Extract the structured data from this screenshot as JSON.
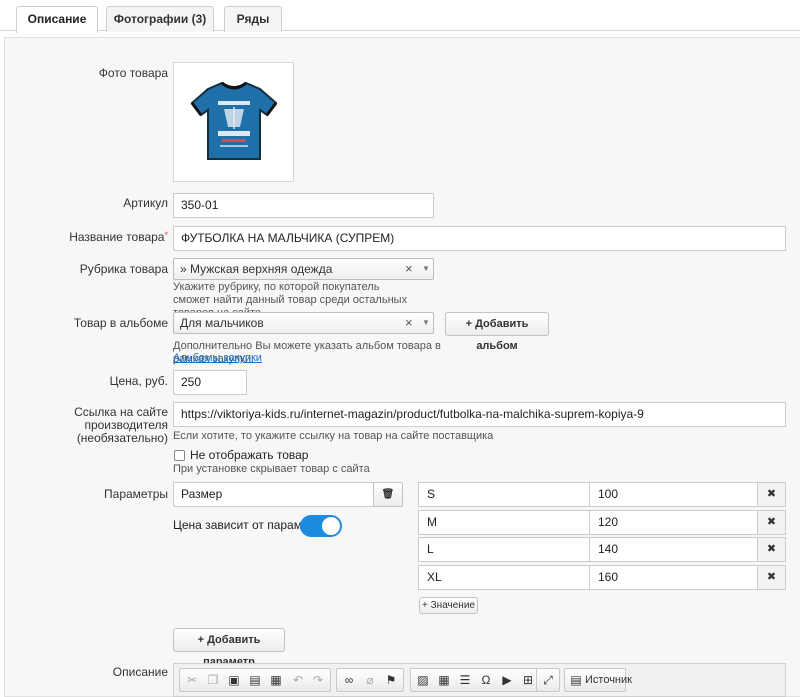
{
  "tabs": [
    {
      "label": "Описание"
    },
    {
      "label": "Фотографии (3)"
    },
    {
      "label": "Ряды"
    }
  ],
  "form": {
    "photo_label": "Фото товара",
    "sku_label": "Артикул",
    "sku_value": "350-01",
    "name_label": "Название товара",
    "required_mark": "*",
    "name_value": "ФУТБОЛКА НА МАЛЬЧИКА (СУПРЕМ)",
    "category_label": "Рубрика товара",
    "category_value": "» Мужская верхняя одежда",
    "category_hint": "Укажите рубрику, по которой покупатель сможет найти данный товар среди остальных товаров на сайте.",
    "album_label": "Товар в альбоме",
    "album_value": "Для мальчиков",
    "add_album_button": "+ Добавить альбом",
    "album_hint": "Дополнительно Вы можете указать альбом товара в рамках закупки.",
    "album_link": "Альбомы закупки",
    "price_label": "Цена, руб.",
    "price_value": "250",
    "url_label_1": "Ссылка на сайте производителя",
    "url_label_2": "(необязательно)",
    "url_value": "https://viktoriya-kids.ru/internet-magazin/product/futbolka-na-malchika-suprem-kopiya-9",
    "url_hint": "Если хотите, то укажите ссылку на товар на сайте поставщика",
    "hide_label": "Не отображать товар",
    "hide_checked": false,
    "hide_hint": "При установке скрывает товар с сайта",
    "params_label": "Параметры",
    "param_name": "Размер",
    "price_depends_label": "Цена зависит от параметра",
    "price_depends_on": true,
    "param_values": [
      {
        "name": "S",
        "price": "100"
      },
      {
        "name": "M",
        "price": "120"
      },
      {
        "name": "L",
        "price": "140"
      },
      {
        "name": "XL",
        "price": "160"
      }
    ],
    "add_value_button": "+ Значение",
    "add_param_button": "+ Добавить параметр",
    "description_label": "Описание",
    "source_button": "Источник"
  },
  "glyphs": {
    "clear": "×",
    "dropdown": "▼",
    "trash": "🗑",
    "delete": "✖"
  },
  "colors": {
    "accent": "#1d8ce0",
    "link": "#1a6fc6",
    "tshirt": "#1f6fa8"
  },
  "icons": [
    "cut-icon",
    "copy-icon",
    "paste-icon",
    "paste-text-icon",
    "paste-word-icon",
    "undo-icon",
    "redo-icon",
    "link-icon",
    "unlink-icon",
    "anchor-icon",
    "image-icon",
    "table-icon",
    "hr-icon",
    "special-char-icon",
    "youtube-icon",
    "plus-icon",
    "maximize-icon",
    "source-icon"
  ]
}
